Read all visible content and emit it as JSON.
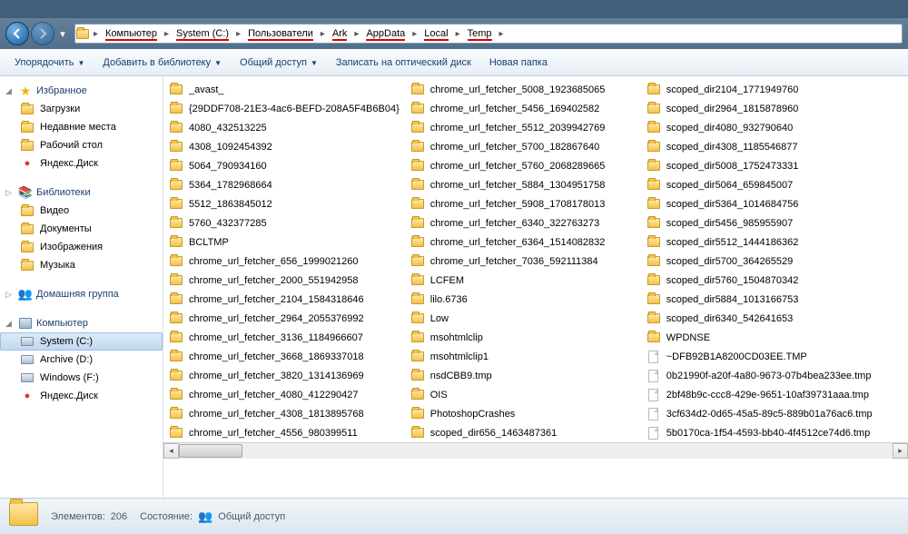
{
  "breadcrumb": [
    {
      "label": "Компьютер",
      "underline": true
    },
    {
      "label": "System (C:)",
      "underline": true
    },
    {
      "label": "Пользователи",
      "underline": true
    },
    {
      "label": "Ark",
      "underline": true
    },
    {
      "label": "AppData",
      "underline": true
    },
    {
      "label": "Local",
      "underline": true
    },
    {
      "label": "Temp",
      "underline": true
    }
  ],
  "toolbar": {
    "organize": "Упорядочить",
    "add_library": "Добавить в библиотеку",
    "share": "Общий доступ",
    "burn": "Записать на оптический диск",
    "new_folder": "Новая папка"
  },
  "sidebar": {
    "favorites": {
      "label": "Избранное",
      "items": [
        {
          "label": "Загрузки",
          "icon": "downloads"
        },
        {
          "label": "Недавние места",
          "icon": "recent"
        },
        {
          "label": "Рабочий стол",
          "icon": "desktop"
        },
        {
          "label": "Яндекс.Диск",
          "icon": "yadisk"
        }
      ]
    },
    "libraries": {
      "label": "Библиотеки",
      "items": [
        {
          "label": "Видео",
          "icon": "video"
        },
        {
          "label": "Документы",
          "icon": "documents"
        },
        {
          "label": "Изображения",
          "icon": "pictures"
        },
        {
          "label": "Музыка",
          "icon": "music"
        }
      ]
    },
    "homegroup": {
      "label": "Домашняя группа"
    },
    "computer": {
      "label": "Компьютер",
      "items": [
        {
          "label": "System (C:)",
          "icon": "drive",
          "selected": true
        },
        {
          "label": "Archive (D:)",
          "icon": "drive"
        },
        {
          "label": "Windows (F:)",
          "icon": "drive"
        },
        {
          "label": "Яндекс.Диск",
          "icon": "yadisk"
        }
      ]
    }
  },
  "files": {
    "col1": [
      {
        "t": "folder",
        "n": "_avast_"
      },
      {
        "t": "folder",
        "n": "{29DDF708-21E3-4ac6-BEFD-208A5F4B6B04}"
      },
      {
        "t": "folder",
        "n": "4080_432513225"
      },
      {
        "t": "folder",
        "n": "4308_1092454392"
      },
      {
        "t": "folder",
        "n": "5064_790934160"
      },
      {
        "t": "folder",
        "n": "5364_1782968664"
      },
      {
        "t": "folder",
        "n": "5512_1863845012"
      },
      {
        "t": "folder",
        "n": "5760_432377285"
      },
      {
        "t": "folder",
        "n": "BCLTMP"
      },
      {
        "t": "folder",
        "n": "chrome_url_fetcher_656_1999021260"
      },
      {
        "t": "folder",
        "n": "chrome_url_fetcher_2000_551942958"
      },
      {
        "t": "folder",
        "n": "chrome_url_fetcher_2104_1584318646"
      },
      {
        "t": "folder",
        "n": "chrome_url_fetcher_2964_2055376992"
      },
      {
        "t": "folder",
        "n": "chrome_url_fetcher_3136_1184966607"
      },
      {
        "t": "folder",
        "n": "chrome_url_fetcher_3668_1869337018"
      },
      {
        "t": "folder",
        "n": "chrome_url_fetcher_3820_1314136969"
      },
      {
        "t": "folder",
        "n": "chrome_url_fetcher_4080_412290427"
      },
      {
        "t": "folder",
        "n": "chrome_url_fetcher_4308_1813895768"
      },
      {
        "t": "folder",
        "n": "chrome_url_fetcher_4556_980399511"
      }
    ],
    "col2": [
      {
        "t": "folder",
        "n": "chrome_url_fetcher_5008_1923685065"
      },
      {
        "t": "folder",
        "n": "chrome_url_fetcher_5456_169402582"
      },
      {
        "t": "folder",
        "n": "chrome_url_fetcher_5512_2039942769"
      },
      {
        "t": "folder",
        "n": "chrome_url_fetcher_5700_182867640"
      },
      {
        "t": "folder",
        "n": "chrome_url_fetcher_5760_2068289665"
      },
      {
        "t": "folder",
        "n": "chrome_url_fetcher_5884_1304951758"
      },
      {
        "t": "folder",
        "n": "chrome_url_fetcher_5908_1708178013"
      },
      {
        "t": "folder",
        "n": "chrome_url_fetcher_6340_322763273"
      },
      {
        "t": "folder",
        "n": "chrome_url_fetcher_6364_1514082832"
      },
      {
        "t": "folder",
        "n": "chrome_url_fetcher_7036_592111384"
      },
      {
        "t": "folder",
        "n": "LCFEM"
      },
      {
        "t": "folder",
        "n": "lilo.6736"
      },
      {
        "t": "folder",
        "n": "Low"
      },
      {
        "t": "folder",
        "n": "msohtmlclip"
      },
      {
        "t": "folder",
        "n": "msohtmlclip1"
      },
      {
        "t": "folder",
        "n": "nsdCBB9.tmp"
      },
      {
        "t": "folder",
        "n": "OIS"
      },
      {
        "t": "folder",
        "n": "PhotoshopCrashes"
      },
      {
        "t": "folder",
        "n": "scoped_dir656_1463487361"
      }
    ],
    "col3": [
      {
        "t": "folder",
        "n": "scoped_dir2104_1771949760"
      },
      {
        "t": "folder",
        "n": "scoped_dir2964_1815878960"
      },
      {
        "t": "folder",
        "n": "scoped_dir4080_932790640"
      },
      {
        "t": "folder",
        "n": "scoped_dir4308_1185546877"
      },
      {
        "t": "folder",
        "n": "scoped_dir5008_1752473331"
      },
      {
        "t": "folder",
        "n": "scoped_dir5064_659845007"
      },
      {
        "t": "folder",
        "n": "scoped_dir5364_1014684756"
      },
      {
        "t": "folder",
        "n": "scoped_dir5456_985955907"
      },
      {
        "t": "folder",
        "n": "scoped_dir5512_1444186362"
      },
      {
        "t": "folder",
        "n": "scoped_dir5700_364265529"
      },
      {
        "t": "folder",
        "n": "scoped_dir5760_1504870342"
      },
      {
        "t": "folder",
        "n": "scoped_dir5884_1013166753"
      },
      {
        "t": "folder",
        "n": "scoped_dir6340_542641653"
      },
      {
        "t": "folder",
        "n": "WPDNSE"
      },
      {
        "t": "file",
        "n": "~DFB92B1A8200CD03EE.TMP"
      },
      {
        "t": "file",
        "n": "0b21990f-a20f-4a80-9673-07b4bea233ee.tmp"
      },
      {
        "t": "file",
        "n": "2bf48b9c-ccc8-429e-9651-10af39731aaa.tmp"
      },
      {
        "t": "file",
        "n": "3cf634d2-0d65-45a5-89c5-889b01a76ac6.tmp"
      },
      {
        "t": "file",
        "n": "5b0170ca-1f54-4593-bb40-4f4512ce74d6.tmp"
      }
    ]
  },
  "status": {
    "elements_label": "Элементов:",
    "elements_count": "206",
    "state_label": "Состояние:",
    "state_value": "Общий доступ"
  }
}
